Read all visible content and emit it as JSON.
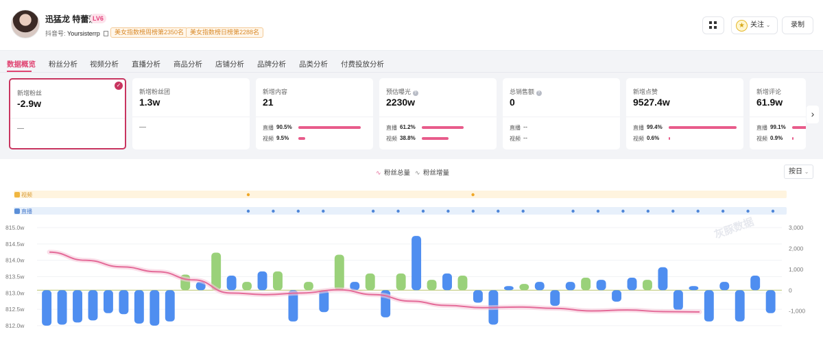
{
  "header": {
    "name": "迅猛龙 特蕾莎",
    "level": "LV6",
    "douyin_label": "抖音号:",
    "douyin_id": "Yoursisterrp",
    "rank_weekly": "美女指数榜周榜第2350名",
    "rank_daily": "美女指数榜日榜第2288名",
    "follow_label": "关注",
    "record_label": "录制"
  },
  "tabs": [
    "数据概览",
    "粉丝分析",
    "视频分析",
    "直播分析",
    "商品分析",
    "店铺分析",
    "品牌分析",
    "品类分析",
    "付费投放分析"
  ],
  "cards": [
    {
      "label": "新增粉丝",
      "value": "-2.9w",
      "dash": "—"
    },
    {
      "label": "新增粉丝团",
      "value": "1.3w",
      "dash": "—"
    },
    {
      "label": "新增内容",
      "value": "21",
      "rows": [
        {
          "name": "直播",
          "pct": "90.5%",
          "frac": 0.905
        },
        {
          "name": "视频",
          "pct": "9.5%",
          "frac": 0.095
        }
      ]
    },
    {
      "label": "预估曝光",
      "value": "2230w",
      "rows": [
        {
          "name": "直播",
          "pct": "61.2%",
          "frac": 0.612
        },
        {
          "name": "视频",
          "pct": "38.8%",
          "frac": 0.388
        }
      ]
    },
    {
      "label": "总销售额",
      "value": "0",
      "rows": [
        {
          "name": "直播",
          "pct": "--"
        },
        {
          "name": "视频",
          "pct": "--"
        }
      ]
    },
    {
      "label": "新增点赞",
      "value": "9527.4w",
      "rows": [
        {
          "name": "直播",
          "pct": "99.4%",
          "frac": 0.994
        },
        {
          "name": "视频",
          "pct": "0.6%",
          "frac": 0.006
        }
      ]
    },
    {
      "label": "新增评论",
      "value": "61.9w",
      "rows": [
        {
          "name": "直播",
          "pct": "99.1%",
          "frac": 0.991
        },
        {
          "name": "视频",
          "pct": "0.9%",
          "frac": 0.009
        }
      ]
    }
  ],
  "chart": {
    "legend_total": "粉丝总量",
    "legend_increase": "粉丝增量",
    "interval": "按日",
    "track_video": "视频",
    "track_live": "直播",
    "watermark": "灰豚数据",
    "colors": {
      "pink": "#e46a98",
      "blue": "#4f8ef0",
      "green": "#9ad17a",
      "video_track": "#fff4df",
      "live_track": "#e7f0fb"
    }
  },
  "chart_data": {
    "type": "bar",
    "left_axis": {
      "ticks": [
        "815.0w",
        "814.5w",
        "814.0w",
        "813.5w",
        "813.0w",
        "812.5w",
        "812.0w"
      ],
      "ylim": [
        812.0,
        815.0
      ]
    },
    "right_axis": {
      "ticks": [
        "3,000",
        "2,000",
        "1,000",
        "0",
        "-1,000"
      ],
      "ylim": [
        -1700,
        3000
      ]
    },
    "series": [
      {
        "name": "粉丝增量",
        "values": [
          -1700,
          -1650,
          -1550,
          -1450,
          -1100,
          -1150,
          -1600,
          -1700,
          -1500,
          750,
          400,
          1800,
          700,
          400,
          900,
          900,
          -1500,
          400,
          -1050,
          1700,
          400,
          800,
          -1300,
          800,
          2600,
          500,
          800,
          700,
          -600,
          -1650,
          200,
          300,
          400,
          -750,
          400,
          600,
          500,
          -550,
          600,
          500,
          1100,
          -950,
          200,
          -1500,
          400,
          -1500,
          700,
          -1100
        ]
      },
      {
        "name": "粉丝总量",
        "values": [
          814.25,
          814.0,
          813.8,
          813.65,
          813.4,
          813.0,
          812.95,
          813.0,
          813.1,
          812.95,
          812.75,
          812.62,
          812.55,
          812.57,
          812.53,
          812.45,
          812.48,
          812.43,
          812.42
        ]
      }
    ],
    "video_markers": [
      9,
      18
    ],
    "live_markers": [
      9,
      10,
      11,
      12,
      14,
      15,
      16,
      17,
      18,
      19,
      20,
      22,
      23,
      24,
      25,
      26,
      27,
      28,
      29,
      30
    ]
  }
}
